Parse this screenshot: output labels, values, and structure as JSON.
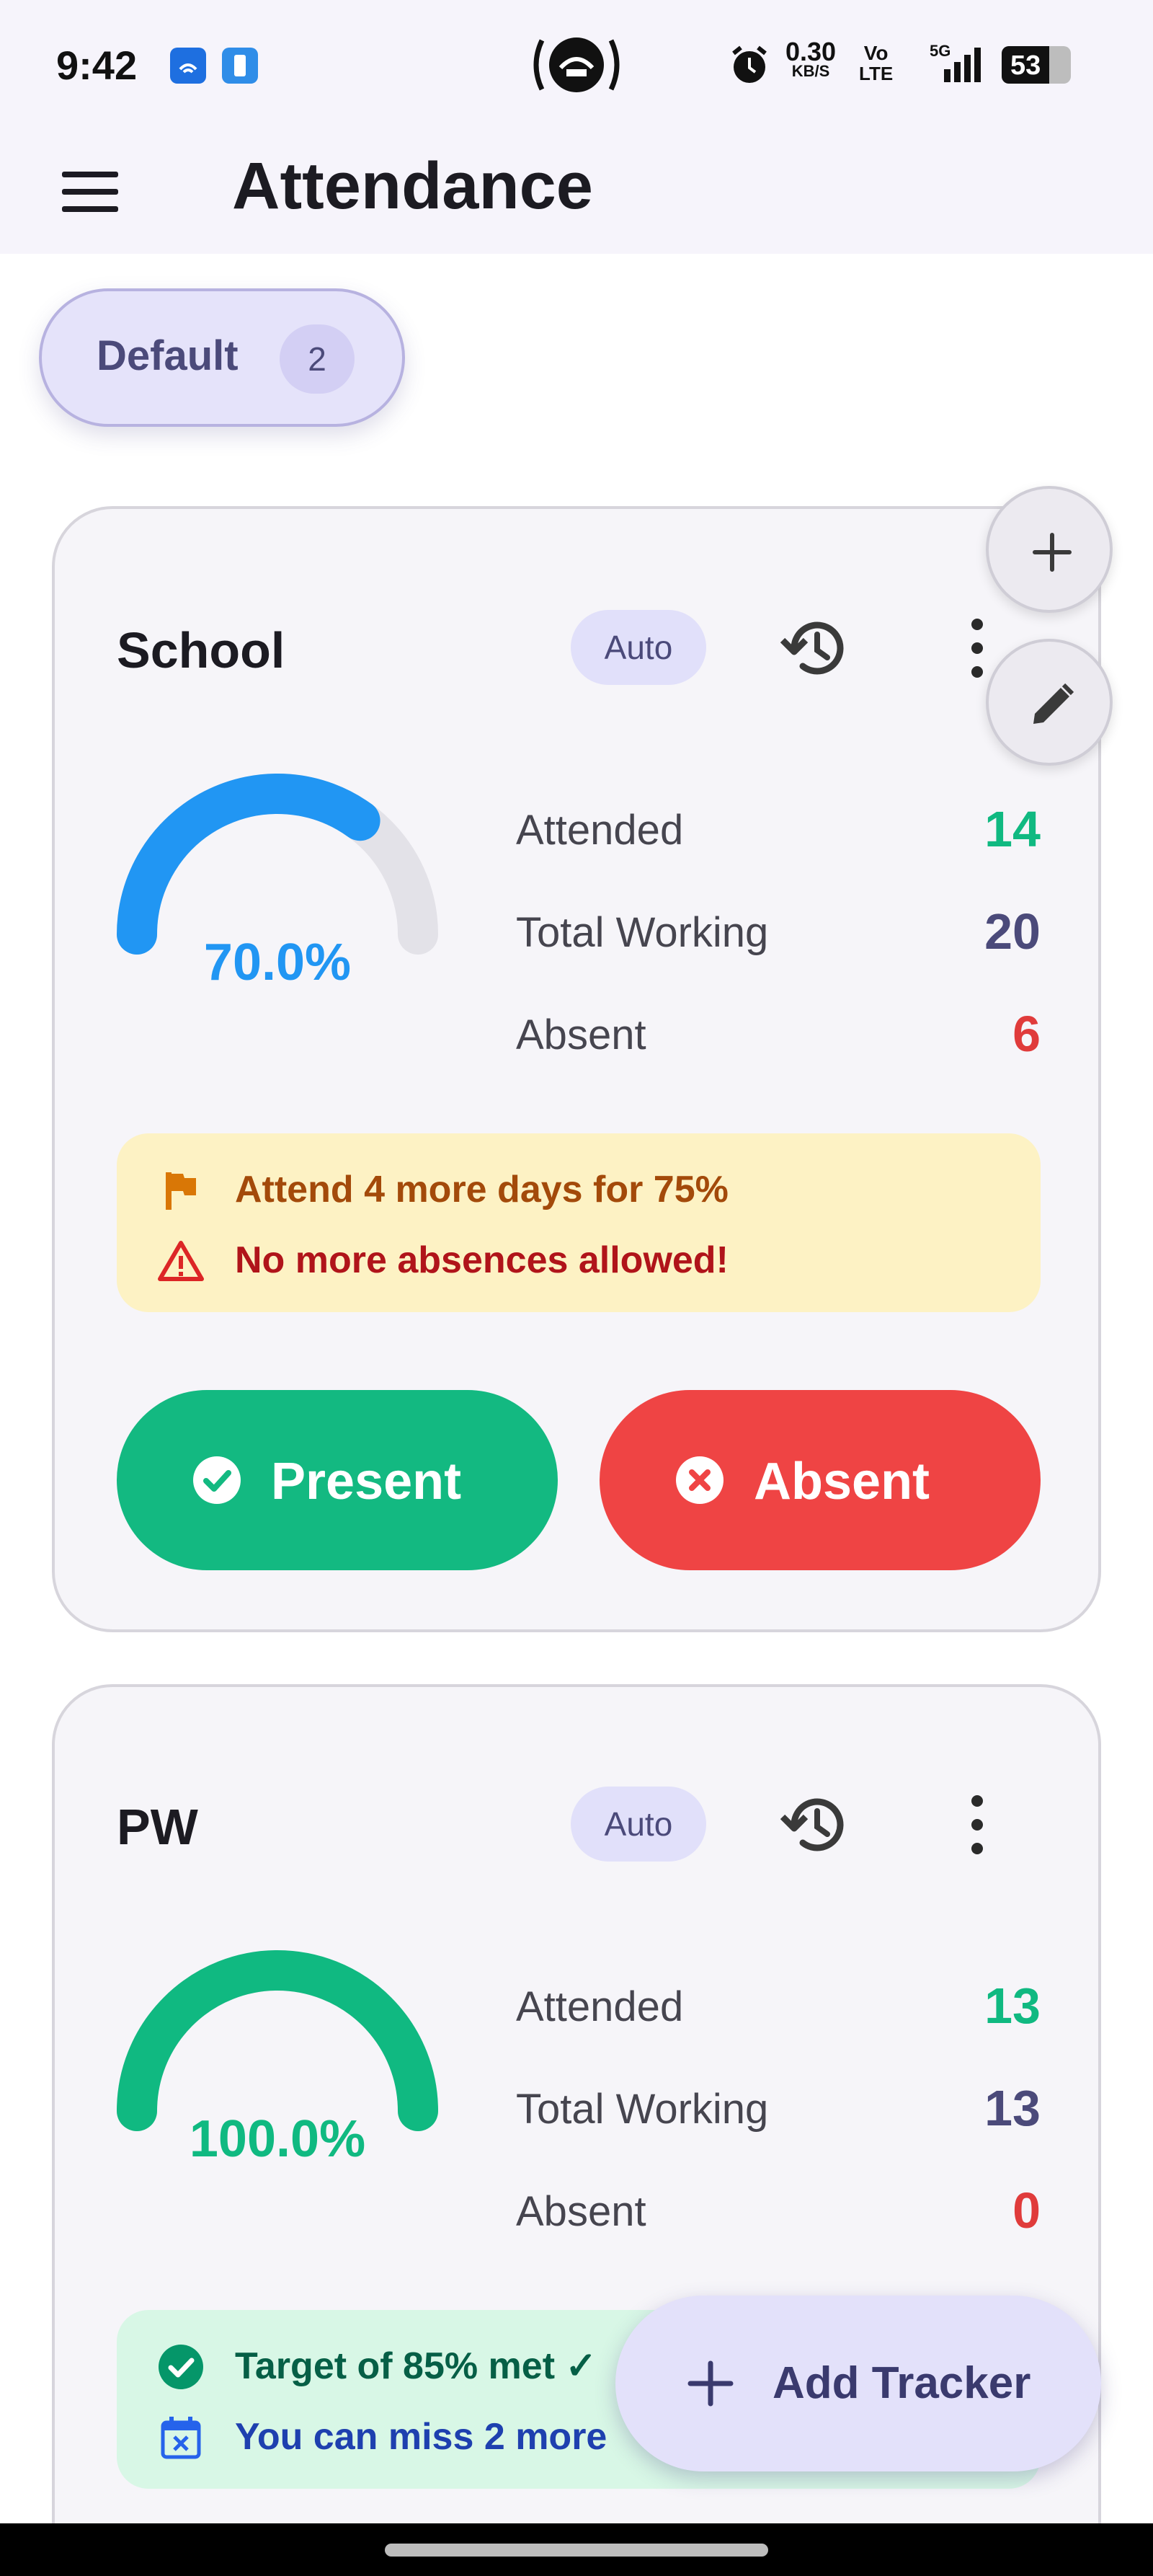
{
  "status_bar": {
    "time": "9:42",
    "net_speed": "0.30",
    "net_unit": "KB/S",
    "volte_top": "Vo",
    "volte_bottom": "LTE",
    "network": "5G",
    "battery": "53",
    "icons": [
      "app-notification-icon",
      "phone-notification-icon",
      "hotspot-icon",
      "alarm-icon",
      "signal-icon",
      "battery-icon"
    ]
  },
  "app_bar": {
    "title": "Attendance",
    "menu_icon": "hamburger-menu-icon"
  },
  "group_chip": {
    "label": "Default",
    "count": "2"
  },
  "trackers": [
    {
      "name": "School",
      "mode": "Auto",
      "percent": 70.0,
      "percent_label": "70.0%",
      "gauge_color": "#2196f3",
      "stats": {
        "attended_label": "Attended",
        "attended": "14",
        "total_label": "Total Working",
        "total": "20",
        "absent_label": "Absent",
        "absent": "6"
      },
      "notices": [
        {
          "icon": "flag-icon",
          "text": "Attend 4 more days for 75%",
          "color": "#a34a0a"
        },
        {
          "icon": "warning-icon",
          "text": "No more absences allowed!",
          "color": "#b0141a"
        }
      ],
      "notice_bg": "#fdf2c4",
      "present_label": "Present",
      "absent_button_label": "Absent"
    },
    {
      "name": "PW",
      "mode": "Auto",
      "percent": 100.0,
      "percent_label": "100.0%",
      "gauge_color": "#10b981",
      "stats": {
        "attended_label": "Attended",
        "attended": "13",
        "total_label": "Total Working",
        "total": "13",
        "absent_label": "Absent",
        "absent": "0"
      },
      "notices": [
        {
          "icon": "check-circle-icon",
          "text": "Target of 85% met ✓",
          "color": "#065f46"
        },
        {
          "icon": "calendar-x-icon",
          "text": "You can miss 2 more",
          "color": "#1e40af"
        }
      ],
      "notice_bg": "#d8f7e6"
    }
  ],
  "floating": {
    "add_icon": "plus-icon",
    "edit_icon": "pencil-icon",
    "add_tracker_label": "Add Tracker"
  },
  "colors": {
    "attended": "#10b981",
    "total": "#4b4a7a",
    "absent": "#e03b3b",
    "present_button": "#13b981",
    "absent_button": "#ef4444"
  }
}
